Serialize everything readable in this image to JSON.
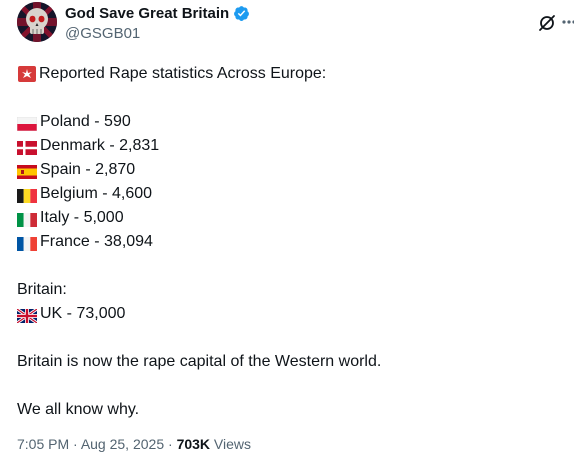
{
  "author": {
    "display_name": "God Save Great Britain",
    "handle": "@GSGB01",
    "verified": true
  },
  "icons": {
    "avatar": "skull-union-jack-avatar",
    "verified": "verified-badge-icon",
    "grok": "grok-icon",
    "more": "more-options-icon"
  },
  "colors": {
    "verified_blue": "#1d9bf0",
    "text_primary": "#0f1419",
    "text_secondary": "#536471"
  },
  "tweet": {
    "heading": "Reported Rape statistics Across Europe:",
    "countries": [
      {
        "flag": "flag-poland",
        "label": "Poland - 590"
      },
      {
        "flag": "flag-denmark",
        "label": "Denmark - 2,831"
      },
      {
        "flag": "flag-spain",
        "label": "Spain - 2,870"
      },
      {
        "flag": "flag-belgium",
        "label": "Belgium - 4,600"
      },
      {
        "flag": "flag-italy",
        "label": "Italy - 5,000"
      },
      {
        "flag": "flag-france",
        "label": "France - 38,094"
      }
    ],
    "britain_heading": "Britain:",
    "uk": {
      "flag": "flag-uk",
      "label": "UK - 73,000"
    },
    "line_capital": "Britain is now the rape capital of the Western world.",
    "line_why": "We all know why."
  },
  "meta": {
    "time": "7:05 PM",
    "separator": " · ",
    "date": "Aug 25, 2025",
    "views_count": "703K",
    "views_label": " Views"
  }
}
